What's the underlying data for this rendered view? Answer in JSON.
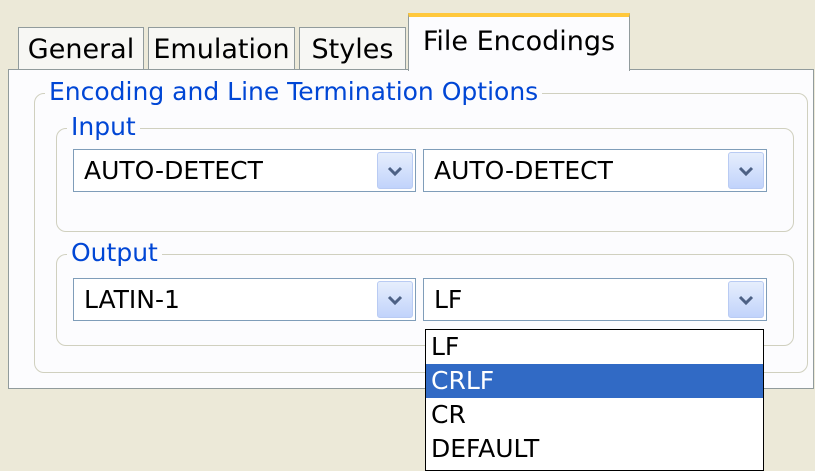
{
  "tabs": [
    {
      "label": "General",
      "active": false
    },
    {
      "label": "Emulation",
      "active": false
    },
    {
      "label": "Styles",
      "active": false
    },
    {
      "label": "File Encodings",
      "active": true
    }
  ],
  "group": {
    "title": "Encoding and Line Termination Options",
    "input": {
      "title": "Input",
      "encoding": "AUTO-DETECT",
      "line_termination": "AUTO-DETECT"
    },
    "output": {
      "title": "Output",
      "encoding": "LATIN-1",
      "line_termination": "LF"
    }
  },
  "dropdown": {
    "options": [
      "LF",
      "CRLF",
      "CR",
      "DEFAULT"
    ],
    "highlighted": "CRLF"
  },
  "icons": {
    "combo_arrow": "chevron-down-icon"
  },
  "colors": {
    "accent": "#0046D5",
    "selection": "#316AC5",
    "active_tab_highlight": "#FFC83C"
  }
}
